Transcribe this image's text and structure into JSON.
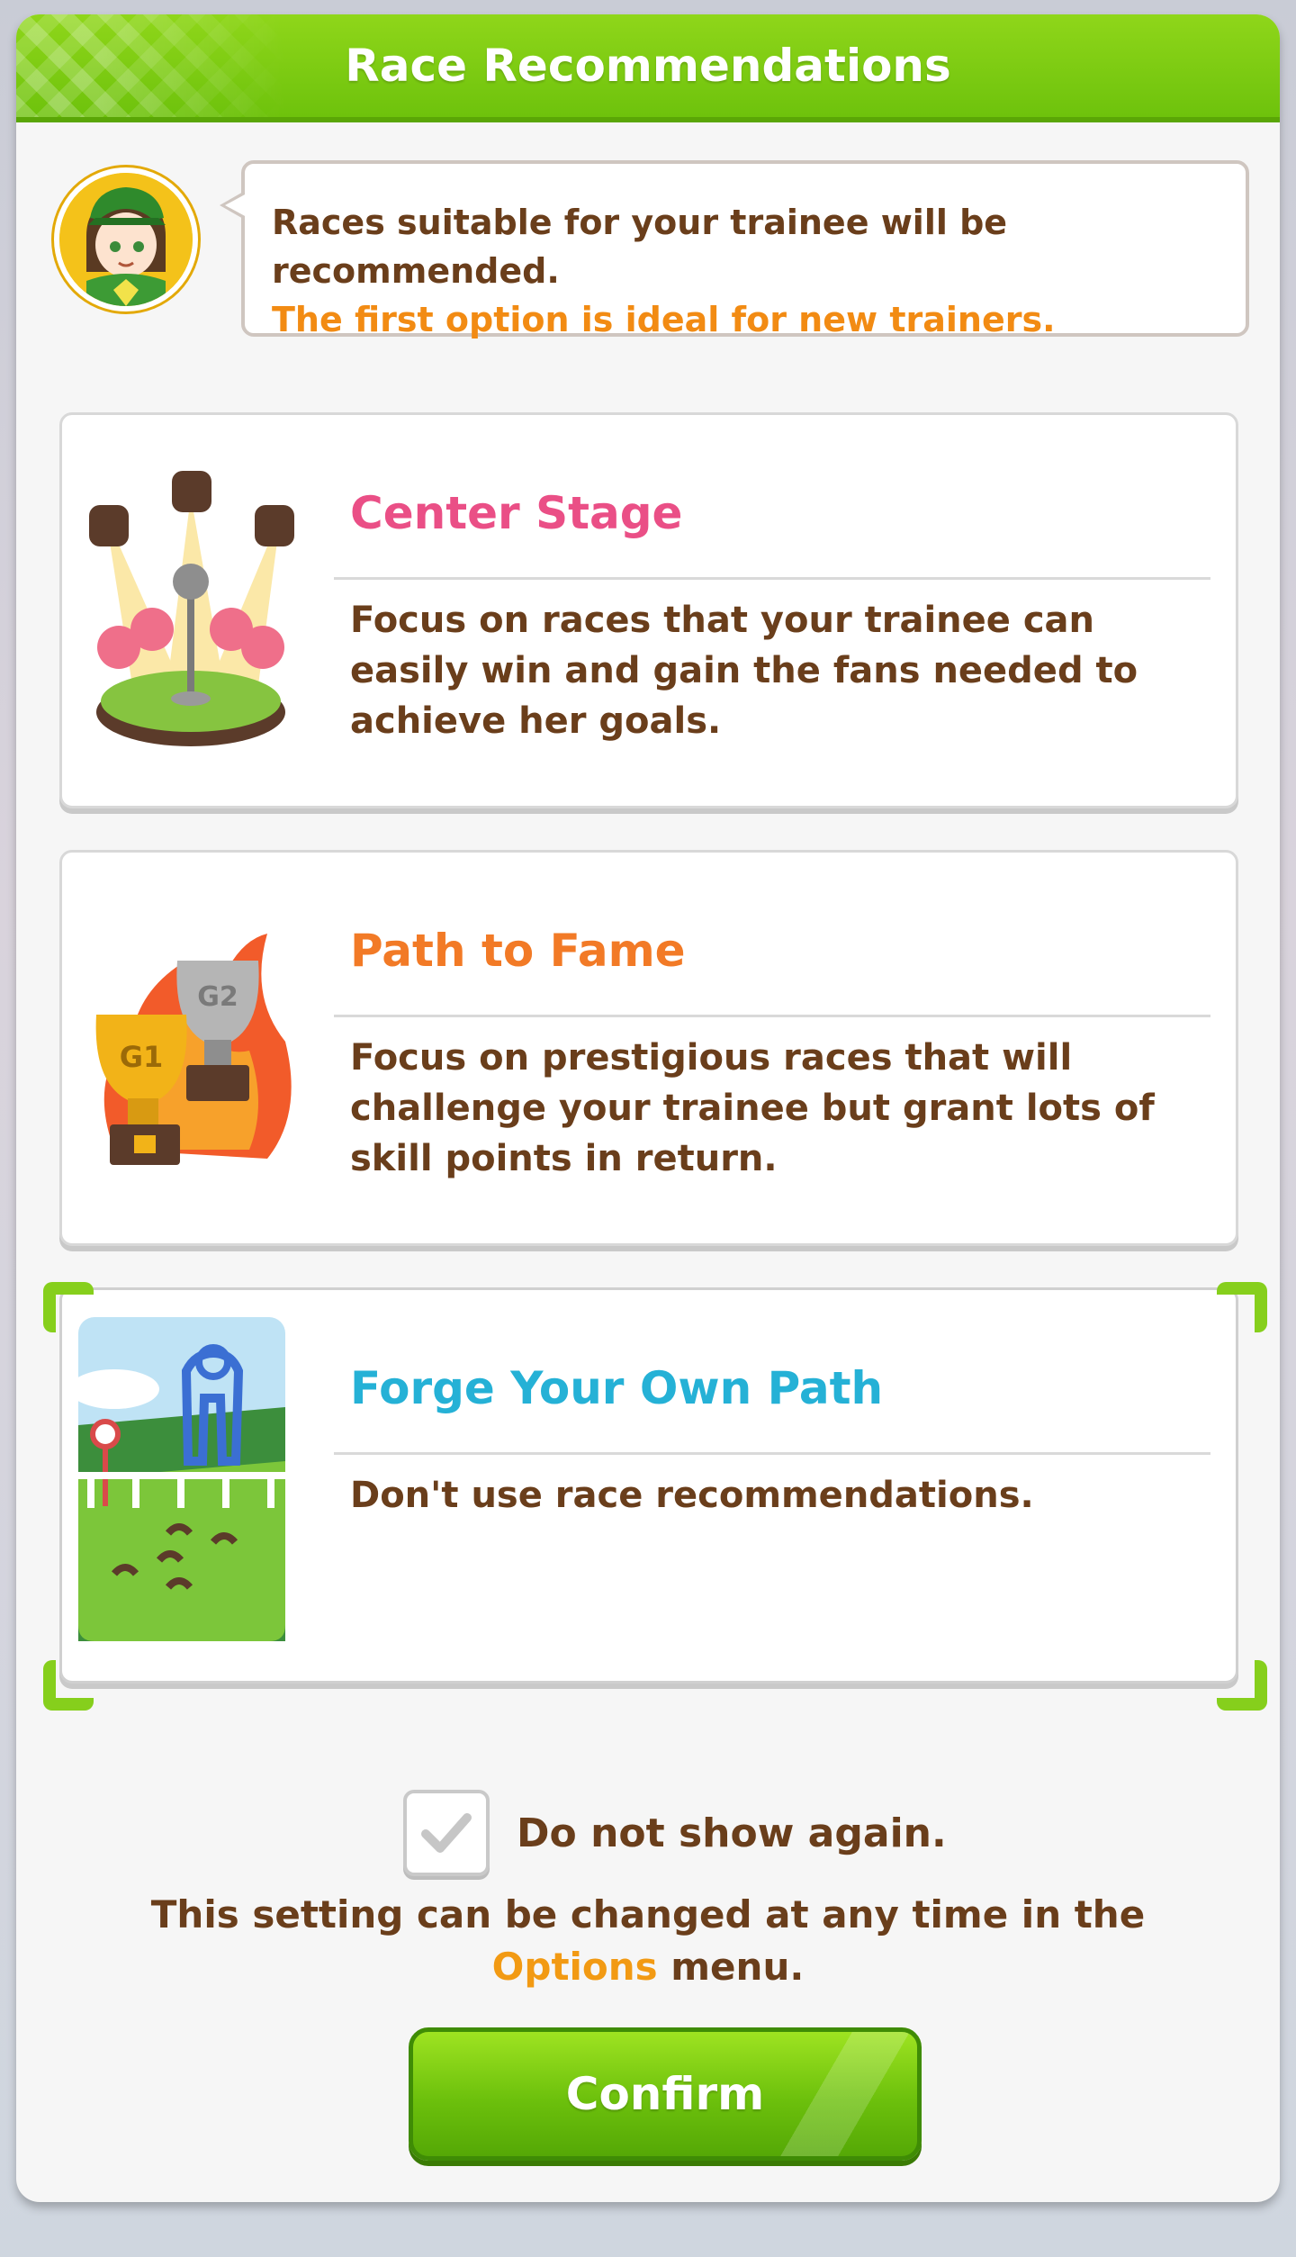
{
  "dialog": {
    "title": "Race Recommendations"
  },
  "speech": {
    "line1": "Races suitable for your trainee will be recommended.",
    "line2": "The first option is ideal for new trainers."
  },
  "options": [
    {
      "title": "Center Stage",
      "description": "Focus on races that your trainee can easily win and gain the fans needed to achieve her goals.",
      "color": "#ea4f86",
      "icon": "spotlight-stage-icon"
    },
    {
      "title": "Path to Fame",
      "description": "Focus on prestigious races that will challenge your trainee but grant lots of skill points in return.",
      "color": "#f27a26",
      "icon": "trophies-icon",
      "badges": [
        "G1",
        "G2"
      ]
    },
    {
      "title": "Forge Your Own Path",
      "description": "Don't use race recommendations.",
      "color": "#25b1d6",
      "icon": "racetrack-icon",
      "selected": true
    }
  ],
  "checkbox": {
    "label": "Do not show again.",
    "checked": true
  },
  "note": {
    "before": "This setting can be changed at any time in the ",
    "link": "Options",
    "after": " menu."
  },
  "confirm_label": "Confirm",
  "colors": {
    "accent_green": "#7acb12",
    "text_brown": "#6a3e1b",
    "highlight_orange": "#f28b13"
  }
}
